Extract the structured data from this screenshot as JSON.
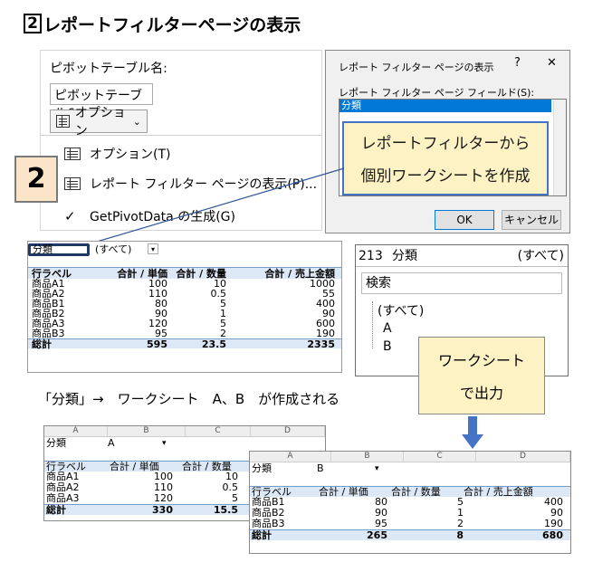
{
  "heading": {
    "step": "2",
    "text": "レポートフィルターページの表示"
  },
  "ribbon": {
    "pivot_name_label": "ピボットテーブル名:",
    "pivot_name_value": "ピボットテーブル6",
    "options_button": "オプション",
    "menu": [
      {
        "label": "オプション(T)",
        "icon": "options-icon"
      },
      {
        "label": "レポート フィルター ページの表示(P)...",
        "icon": "report-filter-pages-icon"
      },
      {
        "label": "GetPivotData の生成(G)",
        "icon": "check-icon"
      }
    ]
  },
  "callout_step": "2",
  "dialog": {
    "title": "レポート フィルター ページの表示",
    "help": "?",
    "close": "✕",
    "field_label": "レポート フィルター ページ フィールド(S):",
    "list_item": "分類",
    "ok": "OK",
    "cancel": "キャンセル"
  },
  "callout_dialog": {
    "line1": "レポートフィルターから",
    "line2": "個別ワークシートを作成"
  },
  "pivot": {
    "filter_label": "分類",
    "filter_value": "(すべて)",
    "headers": [
      "行ラベル",
      "合計 / 単価",
      "合計 / 数量",
      "合計 / 売上金額"
    ],
    "rows": [
      [
        "商品A1",
        "100",
        "10",
        "1000"
      ],
      [
        "商品A2",
        "110",
        "0.5",
        "55"
      ],
      [
        "商品B1",
        "80",
        "5",
        "400"
      ],
      [
        "商品B2",
        "90",
        "1",
        "90"
      ],
      [
        "商品A3",
        "120",
        "5",
        "600"
      ],
      [
        "商品B3",
        "95",
        "2",
        "190"
      ]
    ],
    "total": [
      "総計",
      "595",
      "23.5",
      "2335"
    ]
  },
  "filter_panel": {
    "cell_ref": "213",
    "field": "分類",
    "value": "(すべて)",
    "search_placeholder": "検索",
    "items": [
      "(すべて)",
      "A",
      "B"
    ]
  },
  "callout_output": {
    "line1": "ワークシート",
    "line2": "で出力"
  },
  "caption": "「分類」→　ワークシート　A、B　が作成される",
  "sheet_a": {
    "cols": [
      "A",
      "B",
      "C",
      "D"
    ],
    "filter_label": "分類",
    "filter_value": "A",
    "headers": [
      "行ラベル",
      "合計 / 単価",
      "合計 / 数量"
    ],
    "rows": [
      [
        "商品A1",
        "100",
        "10"
      ],
      [
        "商品A2",
        "110",
        "0.5"
      ],
      [
        "商品A3",
        "120",
        "5"
      ]
    ],
    "total": [
      "総計",
      "330",
      "15.5"
    ]
  },
  "sheet_b": {
    "cols": [
      "A",
      "B",
      "C",
      "D"
    ],
    "filter_label": "分類",
    "filter_value": "B",
    "headers": [
      "行ラベル",
      "合計 / 単価",
      "合計 / 数量",
      "合計 / 売上金額"
    ],
    "rows": [
      [
        "商品B1",
        "80",
        "5",
        "400"
      ],
      [
        "商品B2",
        "90",
        "1",
        "90"
      ],
      [
        "商品B3",
        "95",
        "2",
        "190"
      ]
    ],
    "total": [
      "総計",
      "265",
      "8",
      "680"
    ]
  }
}
